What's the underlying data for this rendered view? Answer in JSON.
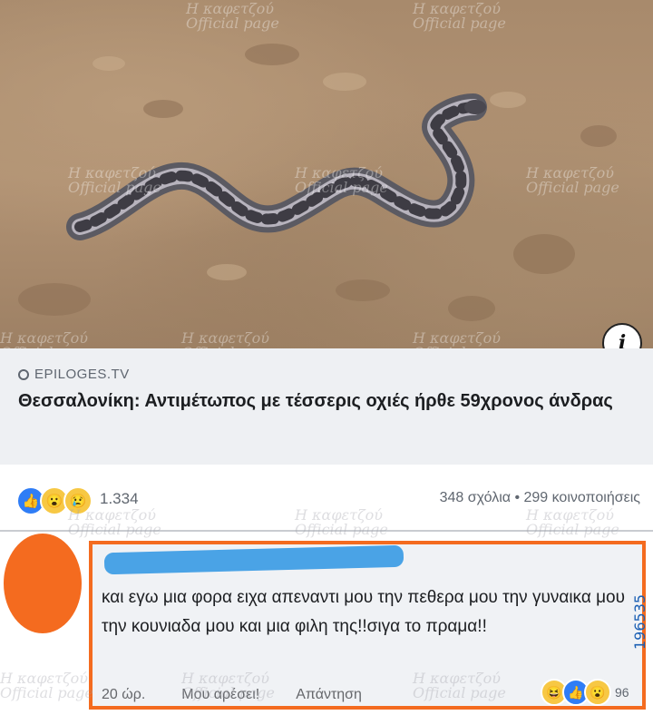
{
  "post": {
    "image_alt": "snake-photo",
    "source": "EPILOGES.TV",
    "headline": "Θεσσαλονίκη: Αντιμέτωπος με τέσσερις οχιές ήρθε 59χρονος άνδρας",
    "reaction_count": "1.334",
    "stats": "348 σχόλια • 299 κοινοποιήσεις",
    "info_glyph": "i"
  },
  "comment": {
    "text": "και εγω μια φορα ειχα απεναντι μου την πεθερα μου την γυναικα μου την κουνιαδα μου και μια φιλη της!!σιγα το πραμα!!",
    "time": "20 ώρ.",
    "like_label": "Μου αρέσει!",
    "reply_label": "Απάντηση",
    "reaction_count": "96"
  },
  "watermark": {
    "line1": "Η καφετζού",
    "line2": "Official page"
  },
  "side_id": "196535",
  "colors": {
    "highlight": "#f46b1f",
    "like_blue": "#2f7df6",
    "scribble_blue": "#4aa3e6"
  }
}
